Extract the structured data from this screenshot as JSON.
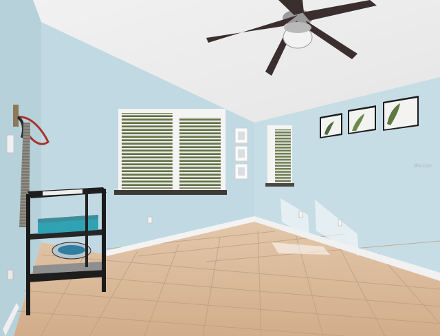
{
  "scene": {
    "description_free": true,
    "colors": {
      "wall_left": "#b9d3dd",
      "wall_back": "#c3dbe4",
      "wall_right": "#c6dce5",
      "ceiling": "#ededed",
      "floor_tile": "#d9b99a",
      "grout": "#b89b80",
      "baseboard": "#f4f4f4",
      "window_sill": "#3c3a38",
      "fan_blade": "#3a2e2e",
      "shelf_frame": "#1d1d1d"
    },
    "icons": [
      "ceiling-fan-icon",
      "window-blinds-icon",
      "shelf-cart-icon",
      "wall-hook-icon",
      "framed-print-icon",
      "outlet-icon"
    ]
  },
  "watermark": {
    "text": "dfw.com"
  }
}
